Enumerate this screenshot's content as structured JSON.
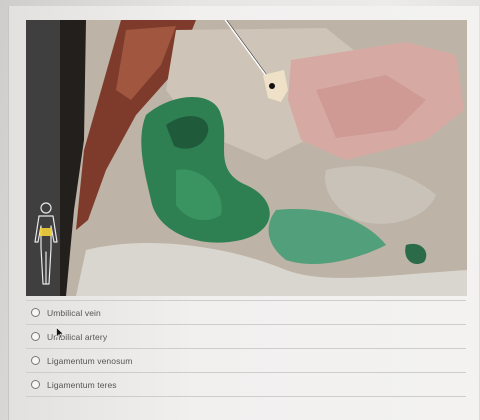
{
  "question": {
    "image": {
      "subject": "cadaver-dissection-photo",
      "body_region_indicator": "abdomen",
      "pointer_marker": "pin"
    },
    "options": [
      {
        "label": "Umbilical vein",
        "selected": false
      },
      {
        "label": "Umbilical artery",
        "selected": false
      },
      {
        "label": "Ligamentum venosum",
        "selected": false
      },
      {
        "label": "Ligamentum teres",
        "selected": false
      }
    ]
  },
  "colors": {
    "page": "#ecebea",
    "tissue": "#c9bfb3",
    "liver": "#d9a8a4",
    "dye": "#2f8a5a",
    "label_text": "#555555",
    "highlight": "#f2d23a"
  }
}
